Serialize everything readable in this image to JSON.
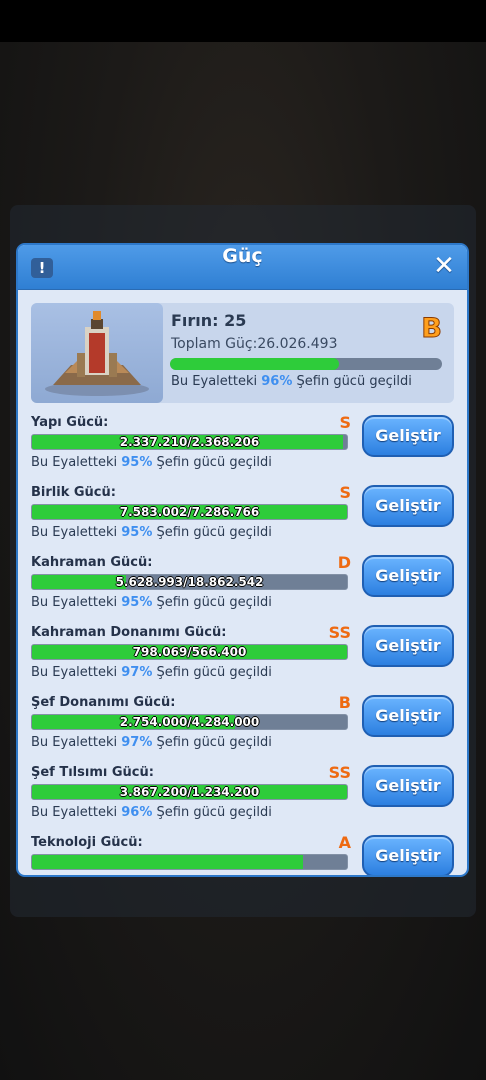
{
  "dialog": {
    "title": "Güç",
    "info_icon": "!",
    "close_icon": "✕"
  },
  "summary": {
    "furnace_label": "Fırın: 25",
    "total_power": "Toplam Güç:26.026.493",
    "grade": "B",
    "progress": 0.62,
    "note_prefix": "Bu Eyaletteki ",
    "note_percent": "96%",
    "note_suffix": " Şefin gücü geçildi"
  },
  "colors": {
    "accent": "#2f7fd3",
    "bar_fill": "#2ecc3a",
    "grade": "#ee6a12",
    "percent": "#3f8ff0"
  },
  "stats": [
    {
      "label": "Yapı Gücü:",
      "grade": "S",
      "value": "2.337.210/2.368.206",
      "progress": 0.987,
      "note_prefix": "Bu Eyaletteki ",
      "percent": "95%",
      "note_suffix": " Şefin gücü geçildi",
      "button": "Geliştir"
    },
    {
      "label": "Birlik Gücü:",
      "grade": "S",
      "value": "7.583.002/7.286.766",
      "progress": 1.0,
      "note_prefix": "Bu Eyaletteki ",
      "percent": "95%",
      "note_suffix": " Şefin gücü geçildi",
      "button": "Geliştir"
    },
    {
      "label": "Kahraman Gücü:",
      "grade": "D",
      "value": "5.628.993/18.862.542",
      "progress": 0.298,
      "note_prefix": "Bu Eyaletteki ",
      "percent": "95%",
      "note_suffix": " Şefin gücü geçildi",
      "button": "Geliştir"
    },
    {
      "label": "Kahraman Donanımı Gücü:",
      "grade": "SS",
      "value": "798.069/566.400",
      "progress": 1.0,
      "note_prefix": "Bu Eyaletteki ",
      "percent": "97%",
      "note_suffix": " Şefin gücü geçildi",
      "button": "Geliştir"
    },
    {
      "label": "Şef Donanımı Gücü:",
      "grade": "B",
      "value": "2.754.000/4.284.000",
      "progress": 0.643,
      "note_prefix": "Bu Eyaletteki ",
      "percent": "97%",
      "note_suffix": " Şefin gücü geçildi",
      "button": "Geliştir"
    },
    {
      "label": "Şef Tılsımı Gücü:",
      "grade": "SS",
      "value": "3.867.200/1.234.200",
      "progress": 1.0,
      "note_prefix": "Bu Eyaletteki ",
      "percent": "96%",
      "note_suffix": " Şefin gücü geçildi",
      "button": "Geliştir"
    },
    {
      "label": "Teknoloji Gücü:",
      "grade": "A",
      "value": "",
      "progress": 0.86,
      "note_prefix": "",
      "percent": "",
      "note_suffix": "",
      "button": "Geliştir"
    }
  ]
}
